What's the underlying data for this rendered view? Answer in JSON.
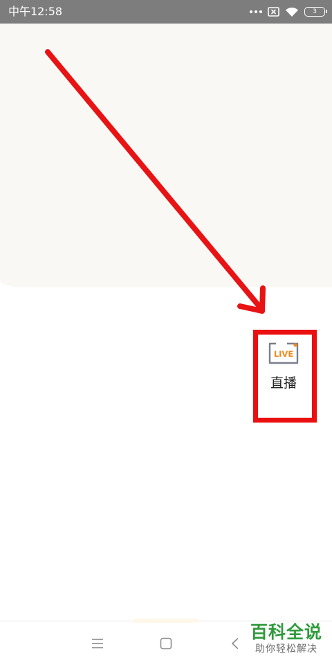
{
  "status_bar": {
    "time": "中午12:58",
    "battery_level": "3",
    "icons": [
      "more-dots-icon",
      "no-sim-icon",
      "wifi-icon",
      "battery-icon"
    ]
  },
  "live_entry": {
    "icon_text": "LIVE",
    "label": "直播",
    "icon": "live-tv-icon"
  },
  "annotation": {
    "arrow_color": "#e81314",
    "box_color": "#ea0f10"
  },
  "nav_bar": {
    "buttons": [
      "menu-icon",
      "home-icon",
      "back-icon"
    ]
  },
  "watermark": {
    "title": "百科全说",
    "subtitle": "助你轻松解决"
  },
  "colors": {
    "status_bar": "#7d7d7d",
    "cream_panel": "#faf8f4",
    "watermark_green": "#2f9a3c"
  }
}
